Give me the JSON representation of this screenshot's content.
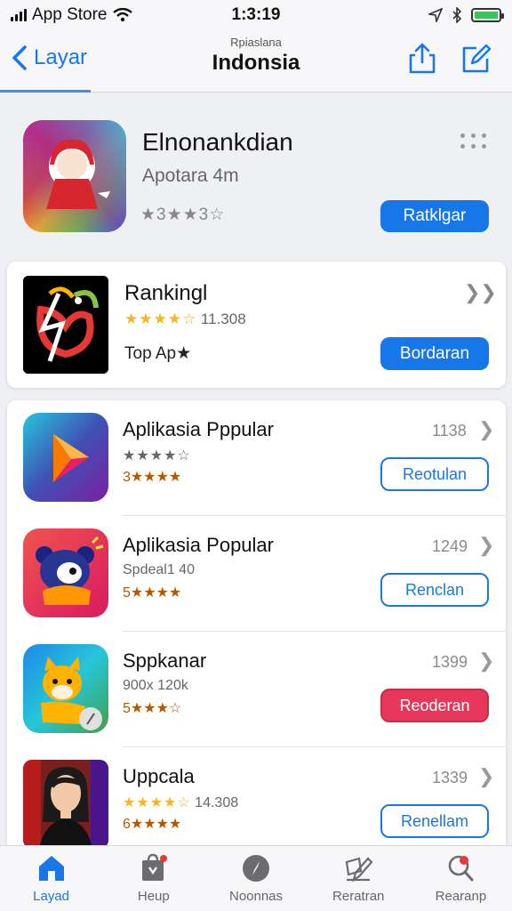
{
  "status_bar": {
    "carrier": "App Store",
    "time": "1:3:19",
    "battery_color": "#35c759"
  },
  "nav": {
    "back_label": "Layar",
    "subtitle": "Rpiaslana",
    "title": "Indonsia",
    "icons": [
      "share-icon",
      "compose-icon"
    ]
  },
  "featured": {
    "title": "Elnonankdian",
    "subtitle": "Apotara 4m",
    "rating": "★3★★3☆",
    "button_label": "Ratklgar"
  },
  "ranking": {
    "title": "Rankingl",
    "stars": "★★★★☆",
    "rating_count": "11.308",
    "subtitle": "Top Ap★",
    "button_label": "Bordaran"
  },
  "list": [
    {
      "title": "Aplikasia Pppular",
      "line2_stars": "★★★★☆",
      "line3": "3★★★★",
      "number": "1138",
      "button_label": "Reotulan",
      "button_style": "outline"
    },
    {
      "title": "Aplikasia Popular",
      "line2": "Spdeal1 40",
      "line3": "5★★★★",
      "number": "1249",
      "button_label": "Renclan",
      "button_style": "outline"
    },
    {
      "title": "Sppkanar",
      "line2": "900x 120k",
      "line3": "5★★★☆",
      "number": "1399",
      "button_label": "Reoderan",
      "button_style": "alert"
    },
    {
      "title": "Uppcala",
      "line2_stars": "★★★★☆",
      "line2_count": "14.308",
      "line3": "6★★★★",
      "number": "1339",
      "button_label": "Renellam",
      "button_style": "outline"
    }
  ],
  "tabs": [
    {
      "label": "Layad",
      "icon": "home-icon",
      "active": true
    },
    {
      "label": "Heup",
      "icon": "store-icon",
      "active": false
    },
    {
      "label": "Noonnas",
      "icon": "compass-icon",
      "active": false
    },
    {
      "label": "Reratran",
      "icon": "edit-icon",
      "active": false
    },
    {
      "label": "Rearanp",
      "icon": "search-icon",
      "active": false
    }
  ],
  "colors": {
    "accent": "#1877e8",
    "alert": "#e8385a",
    "star": "#f3b62b"
  }
}
